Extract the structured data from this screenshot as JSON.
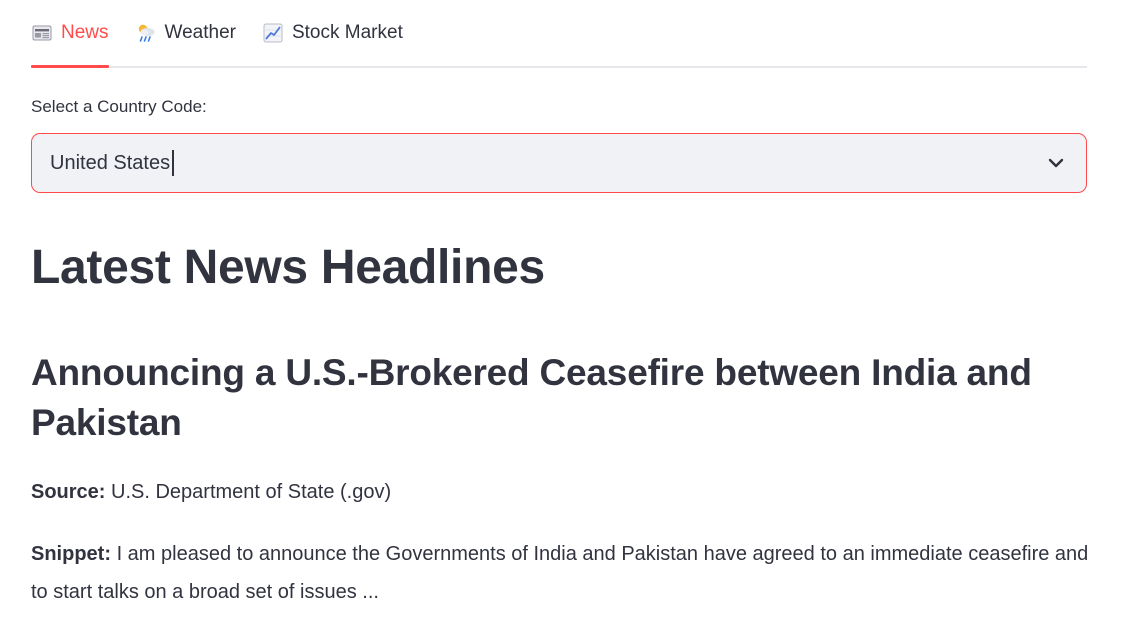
{
  "tabs": [
    {
      "label": "News",
      "icon": "newspaper-icon",
      "active": true
    },
    {
      "label": "Weather",
      "icon": "weather-icon",
      "active": false
    },
    {
      "label": "Stock Market",
      "icon": "chart-increasing-icon",
      "active": false
    }
  ],
  "select": {
    "label": "Select a Country Code:",
    "value": "United States"
  },
  "page_title": "Latest News Headlines",
  "article": {
    "title": "Announcing a U.S.-Brokered Ceasefire between India and Pakistan",
    "source_label": "Source:",
    "source": "U.S. Department of State (.gov)",
    "snippet_label": "Snippet:",
    "snippet": "I am pleased to announce the Governments of India and Pakistan have agreed to an immediate ceasefire and to start talks on a broad set of issues ..."
  },
  "colors": {
    "accent": "#ff4b4b",
    "text": "#31333f",
    "input_bg": "#f0f2f6"
  }
}
